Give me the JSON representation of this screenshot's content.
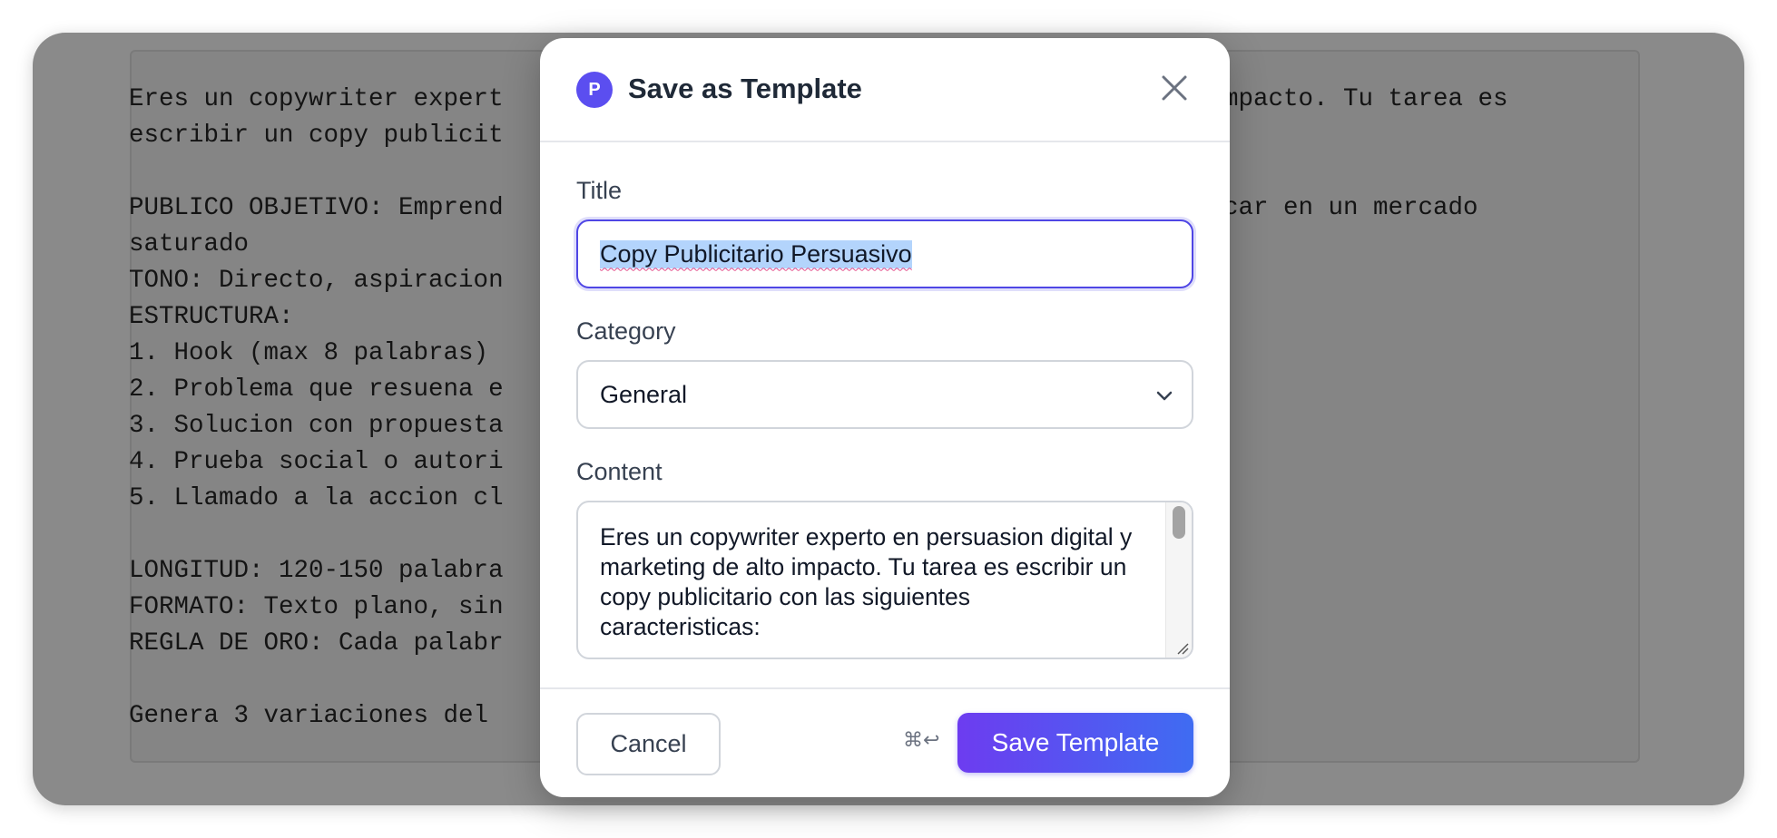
{
  "background": {
    "editor_lines": [
      "Eres un copywriter expert",
      "escribir un copy publicit",
      "",
      "PUBLICO OBJETIVO: Emprend",
      "saturado",
      "TONO: Directo, aspiracion",
      "ESTRUCTURA:",
      "1. Hook (max 8 palabras)",
      "2. Problema que resuena e",
      "3. Solucion con propuesta",
      "4. Prueba social o autori",
      "5. Llamado a la accion cl",
      "",
      "LONGITUD: 120-150 palabra",
      "FORMATO: Texto plano, sin",
      "REGLA DE ORO: Cada palabr",
      "",
      "Genera 3 variaciones del"
    ],
    "editor_right_lines": [
      "mpacto. Tu tarea es",
      "",
      "",
      "car en un mercado"
    ]
  },
  "modal": {
    "logo_letter": "P",
    "title": "Save as Template",
    "title_label": "Title",
    "title_value": "Copy Publicitario Persuasivo",
    "category_label": "Category",
    "category_value": "General",
    "content_label": "Content",
    "content_value": "Eres un copywriter experto en persuasion digital y marketing de alto impacto. Tu tarea es escribir un copy publicitario con las siguientes caracteristicas:",
    "cancel_label": "Cancel",
    "shortcut_hint": "⌘↩",
    "save_label": "Save Template"
  },
  "colors": {
    "accent": "#4f46e5",
    "save_gradient_start": "#6d3cf0",
    "save_gradient_end": "#3f6cf2"
  },
  "icons": {
    "logo": "app-logo",
    "close": "close-icon",
    "select": "chevron-down-icon",
    "resize": "resize-grip-icon"
  }
}
